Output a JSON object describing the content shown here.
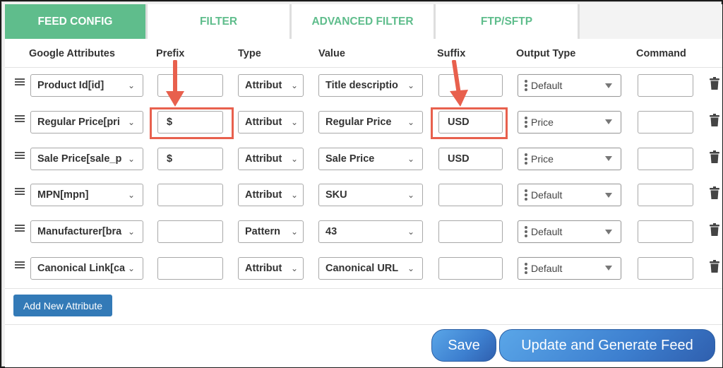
{
  "tabs": [
    {
      "label": "FEED CONFIG",
      "active": true
    },
    {
      "label": "FILTER",
      "active": false
    },
    {
      "label": "ADVANCED FILTER",
      "active": false
    },
    {
      "label": "FTP/SFTP",
      "active": false
    }
  ],
  "columns": {
    "google_attributes": "Google Attributes",
    "prefix": "Prefix",
    "type": "Type",
    "value": "Value",
    "suffix": "Suffix",
    "output_type": "Output Type",
    "command": "Command"
  },
  "rows": [
    {
      "attribute": "Product Id[id]",
      "prefix": "",
      "type": "Attribut",
      "value": "Title descriptio",
      "suffix": "",
      "output_type": "Default",
      "command": ""
    },
    {
      "attribute": "Regular Price[pri",
      "prefix": "$",
      "type": "Attribut",
      "value": "Regular Price",
      "suffix": "USD",
      "output_type": "Price",
      "command": ""
    },
    {
      "attribute": "Sale Price[sale_p",
      "prefix": "$",
      "type": "Attribut",
      "value": "Sale Price",
      "suffix": "USD",
      "output_type": "Price",
      "command": ""
    },
    {
      "attribute": "MPN[mpn]",
      "prefix": "",
      "type": "Attribut",
      "value": "SKU",
      "suffix": "",
      "output_type": "Default",
      "command": ""
    },
    {
      "attribute": "Manufacturer[bra",
      "prefix": "",
      "type": "Pattern",
      "value": "43",
      "suffix": "",
      "output_type": "Default",
      "command": ""
    },
    {
      "attribute": "Canonical Link[ca",
      "prefix": "",
      "type": "Attribut",
      "value": "Canonical URL",
      "suffix": "",
      "output_type": "Default",
      "command": ""
    }
  ],
  "actions": {
    "add_new_attribute": "Add New Attribute",
    "save": "Save",
    "update_generate": "Update and Generate Feed"
  },
  "colors": {
    "tab_accent": "#5fbd8c",
    "annotation": "#e8604d",
    "primary_button": "#337ab7"
  }
}
